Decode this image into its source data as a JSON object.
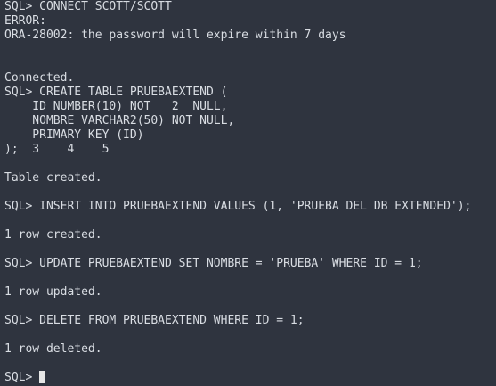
{
  "terminal": {
    "lines": [
      "SQL> CONNECT SCOTT/SCOTT",
      "ERROR:",
      "ORA-28002: the password will expire within 7 days",
      "",
      "",
      "Connected.",
      "SQL> CREATE TABLE PRUEBAEXTEND (",
      "    ID NUMBER(10) NOT   2  NULL,",
      "    NOMBRE VARCHAR2(50) NOT NULL,",
      "    PRIMARY KEY (ID)",
      ");  3    4    5",
      "",
      "Table created.",
      "",
      "SQL> INSERT INTO PRUEBAEXTEND VALUES (1, 'PRUEBA DEL DB EXTENDED');",
      "",
      "1 row created.",
      "",
      "SQL> UPDATE PRUEBAEXTEND SET NOMBRE = 'PRUEBA' WHERE ID = 1;",
      "",
      "1 row updated.",
      "",
      "SQL> DELETE FROM PRUEBAEXTEND WHERE ID = 1;",
      "",
      "1 row deleted.",
      ""
    ],
    "prompt": "SQL> "
  },
  "colors": {
    "background": "#2f343f",
    "text": "#d9dde3",
    "cursor": "#e6e6e6"
  }
}
